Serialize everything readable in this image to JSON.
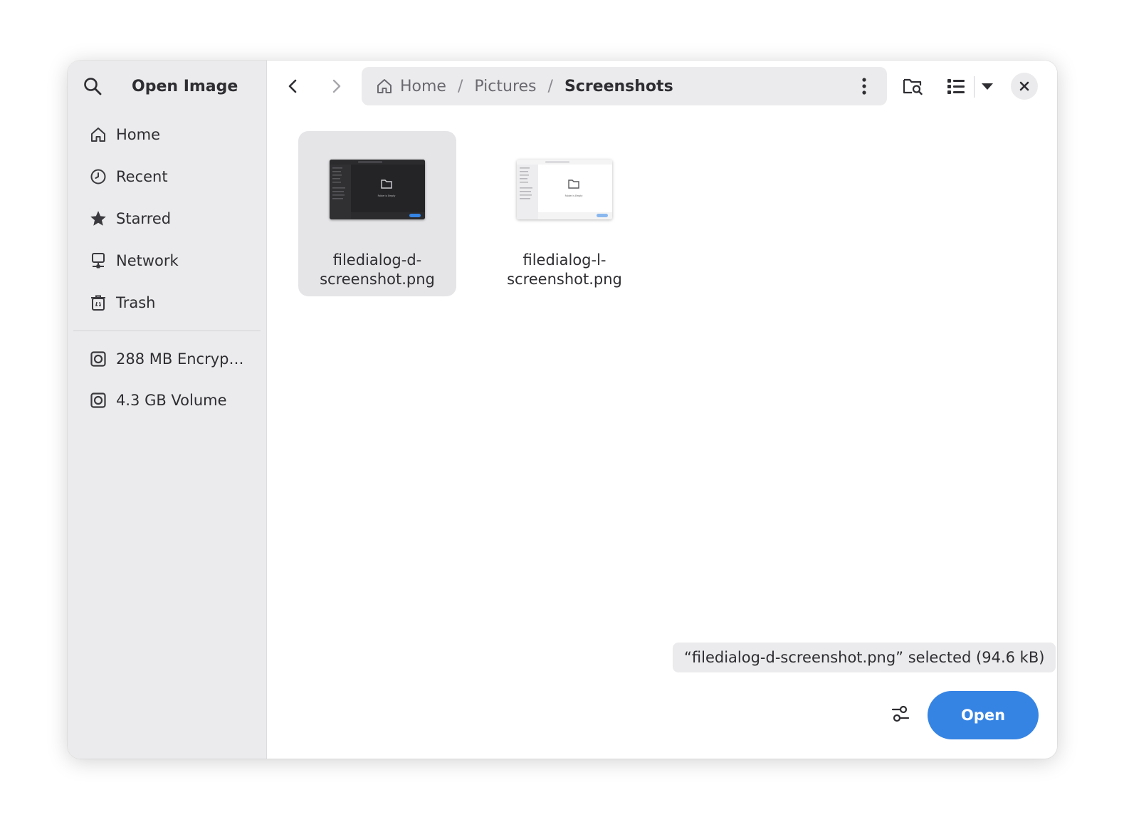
{
  "window": {
    "title": "Open Image"
  },
  "sidebar": {
    "search_icon": "search-icon",
    "places": [
      {
        "label": "Home",
        "icon": "home-icon"
      },
      {
        "label": "Recent",
        "icon": "clock-icon"
      },
      {
        "label": "Starred",
        "icon": "star-icon"
      },
      {
        "label": "Network",
        "icon": "network-icon"
      },
      {
        "label": "Trash",
        "icon": "trash-icon"
      }
    ],
    "volumes": [
      {
        "label": "288 MB Encryp…",
        "icon": "drive-icon"
      },
      {
        "label": "4.3 GB Volume",
        "icon": "drive-icon"
      }
    ]
  },
  "pathbar": {
    "crumbs": [
      "Home",
      "Pictures",
      "Screenshots"
    ],
    "separator": "/"
  },
  "files": [
    {
      "name_line1": "filedialog-d-",
      "name_line2": "screenshot.png",
      "selected": true,
      "thumbnail": "dark"
    },
    {
      "name_line1": "filedialog-l-",
      "name_line2": "screenshot.png",
      "selected": false,
      "thumbnail": "light"
    }
  ],
  "thumbnail_caption": "Folder is Empty",
  "status": {
    "text": "“filedialog-d-screenshot.png” selected  (94.6 kB)"
  },
  "actions": {
    "open_label": "Open"
  },
  "colors": {
    "accent": "#3584e4",
    "sidebar_bg": "#ebebed",
    "selection_bg": "#e5e5e8"
  }
}
